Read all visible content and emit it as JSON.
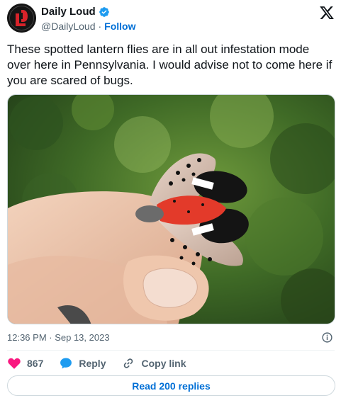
{
  "author": {
    "display_name": "Daily Loud",
    "handle": "@DailyLoud",
    "separator": "·",
    "follow_label": "Follow",
    "avatar_initials": "DL",
    "avatar_color": "#d8232a",
    "verified_color": "#1d9bf0"
  },
  "tweet": {
    "text": "These spotted lantern flies are in all out infestation mode over here in Pennsylvania. I would advise not to come here if you are scared of bugs.",
    "timestamp": "12:36 PM · Sep 13, 2023"
  },
  "actions": {
    "like_count": "867",
    "reply_label": "Reply",
    "copy_link_label": "Copy link",
    "like_color": "#f91880",
    "reply_color": "#1d9bf0"
  },
  "footer": {
    "read_replies_label": "Read 200 replies"
  },
  "icons": {
    "platform": "x-logo-icon",
    "info": "info-icon",
    "heart": "heart-icon",
    "reply": "reply-bubble-icon",
    "link": "link-icon",
    "verified": "verified-badge-icon"
  }
}
